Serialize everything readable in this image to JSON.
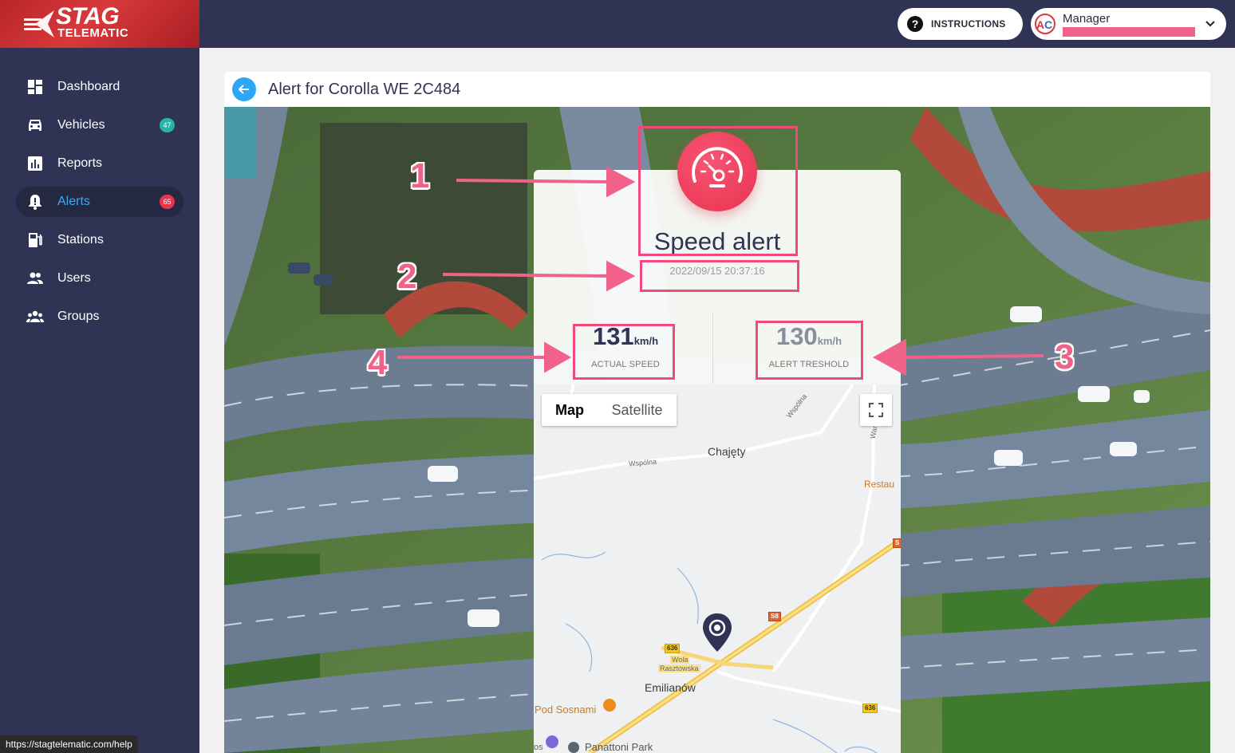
{
  "topbar": {
    "logo_line1": "STAG",
    "logo_line2": "TELEMATIC",
    "instructions_label": "INSTRUCTIONS",
    "user_name": "Manager"
  },
  "sidebar": {
    "items": [
      {
        "label": "Dashboard",
        "icon": "dashboard-icon"
      },
      {
        "label": "Vehicles",
        "icon": "car-icon",
        "badge": "47",
        "badge_color": "#26b5a3"
      },
      {
        "label": "Reports",
        "icon": "report-icon"
      },
      {
        "label": "Alerts",
        "icon": "bell-icon",
        "badge": "65",
        "badge_color": "#e8334f",
        "active": true
      },
      {
        "label": "Stations",
        "icon": "fuel-station-icon"
      },
      {
        "label": "Users",
        "icon": "users-icon"
      },
      {
        "label": "Groups",
        "icon": "groups-icon"
      }
    ]
  },
  "status_url": "https://stagtelematic.com/help",
  "page": {
    "title": "Alert for Corolla WE 2C484"
  },
  "alert": {
    "type": "Speed alert",
    "timestamp": "2022/09/15 20:37:16",
    "actual_speed": {
      "value": "131",
      "unit": "km/h",
      "label": "ACTUAL SPEED"
    },
    "threshold": {
      "value": "130",
      "unit": "km/h",
      "label": "ALERT TRESHOLD"
    },
    "icon": "speedometer-icon"
  },
  "map": {
    "map_label": "Map",
    "satellite_label": "Satellite",
    "places": {
      "chajety": "Chajęty",
      "emilianow": "Emilianów",
      "pod_sosnami": "Pod Sosnami",
      "panattoni": "Panattoni Park",
      "restau": "Restau",
      "wspolna1": "Wspólna",
      "wspolna2": "Wspólna",
      "war": "War",
      "wola": "Wola",
      "rasztowska": "Rasztowska",
      "os": "os"
    },
    "road_shields": {
      "r636a": "636",
      "r636b": "636",
      "s8": "S8",
      "s": "S"
    }
  },
  "annotations": [
    "1",
    "2",
    "3",
    "4"
  ],
  "colors": {
    "sidebar_bg": "#2f3454",
    "accent_blue": "#2da7f5",
    "alert_red": "#e8334f",
    "annotation_pink": "#ee4b7c"
  }
}
